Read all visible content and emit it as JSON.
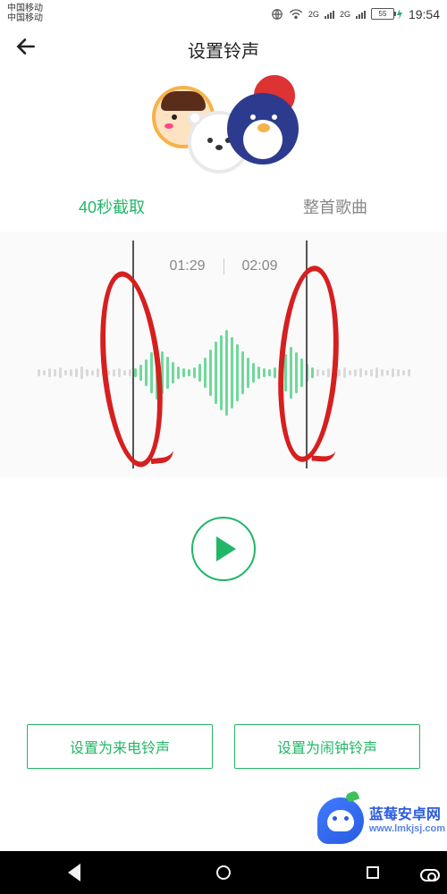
{
  "status": {
    "carrier1": "中国移动",
    "carrier2": "中国移动",
    "net1": "2G",
    "net2": "2G",
    "battery": "55",
    "time": "19:54"
  },
  "header": {
    "title": "设置铃声"
  },
  "tabs": {
    "clip": "40秒截取",
    "full": "整首歌曲"
  },
  "editor": {
    "start_time": "01:29",
    "end_time": "02:09"
  },
  "actions": {
    "set_call": "设置为来电铃声",
    "set_alarm": "设置为闹钟铃声"
  },
  "watermark": {
    "line1": "蓝莓安卓网",
    "line2": "www.lmkjsj.com"
  }
}
